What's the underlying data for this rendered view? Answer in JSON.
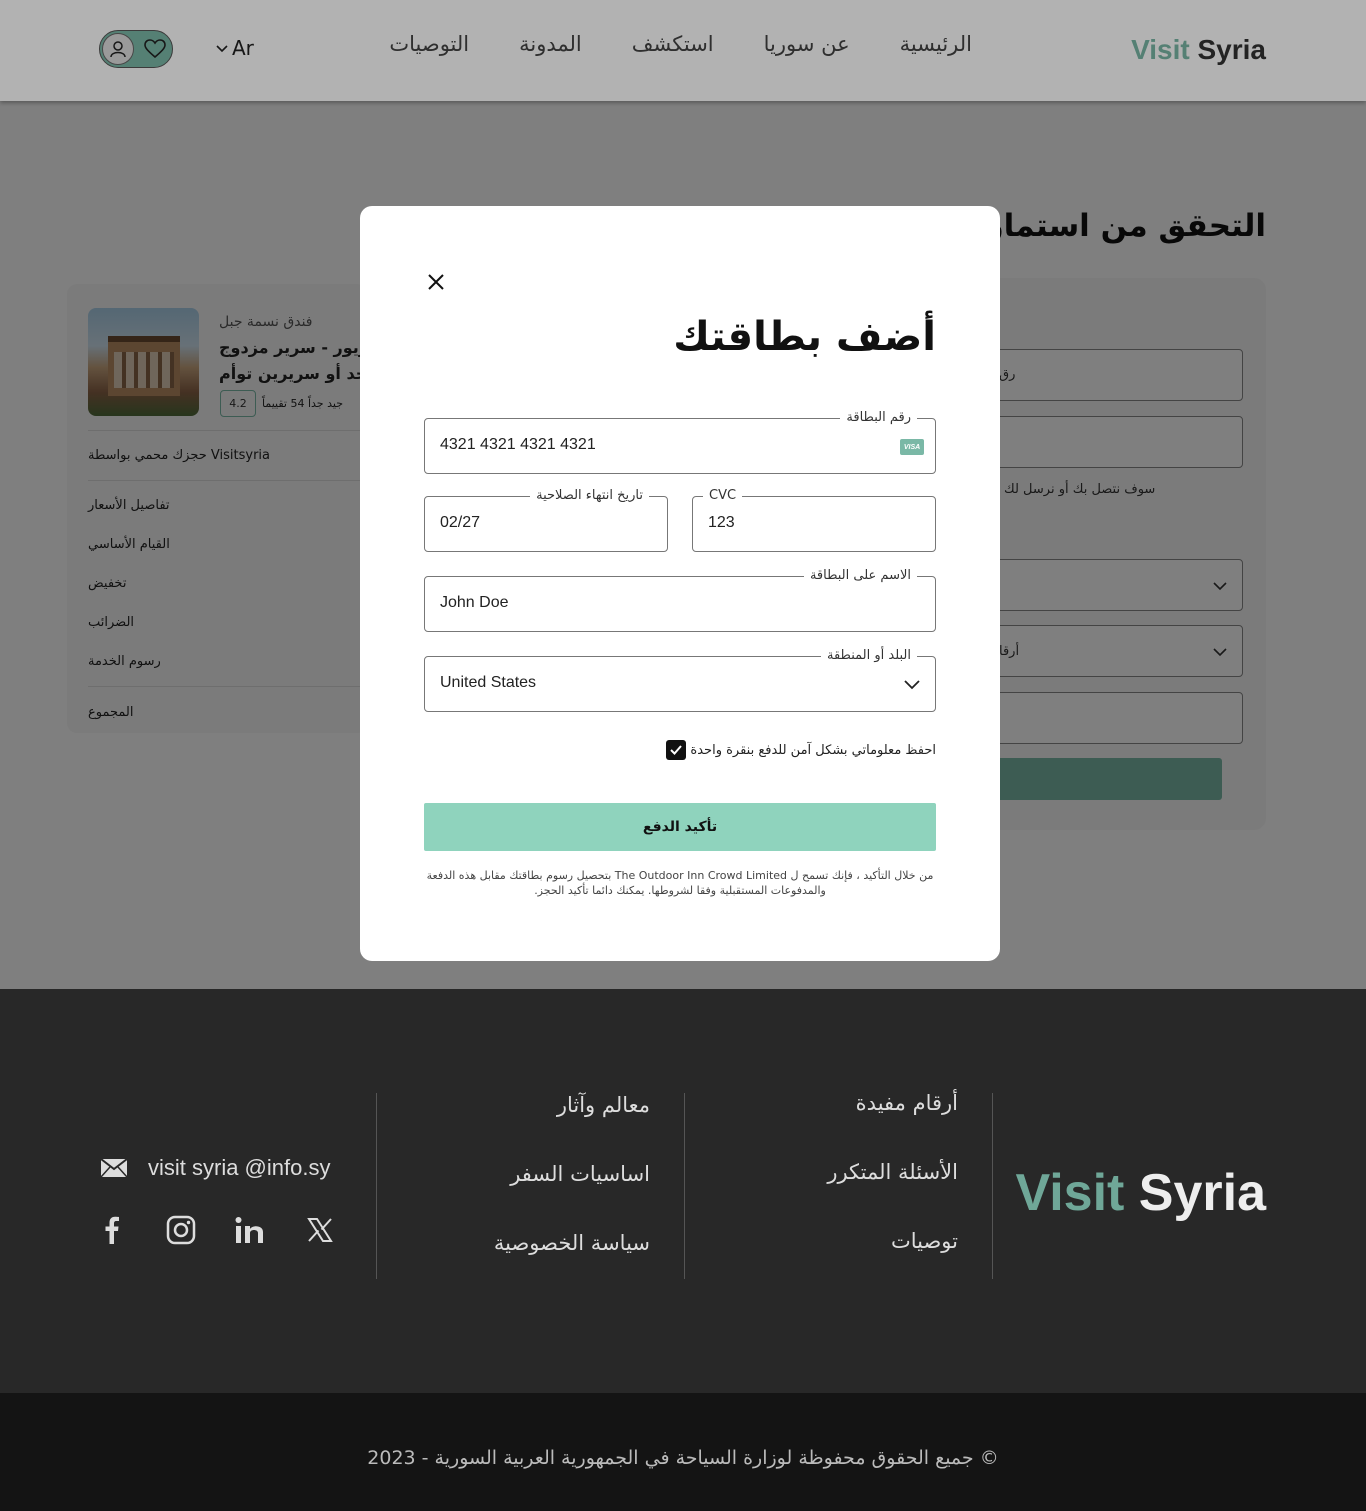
{
  "header": {
    "logo_visit": "Visit",
    "logo_syria": "Syria",
    "nav": [
      "الرئيسية",
      "عن سوريا",
      "استكشف",
      "المدونة",
      "التوصيات"
    ],
    "language": "Ar"
  },
  "page": {
    "title": "التحقق من استمارة ا",
    "field_text_1": "رق",
    "notice": "سوف نتصل بك أو نرسل لك",
    "field_text_2": "أرقا"
  },
  "summary": {
    "hotel_type": "فندق نسمة جبل",
    "room_line1": "ييريور - سرير مزدوج",
    "room_line2": "احد أو سريرين توأم",
    "rating": "4.2",
    "rating_text": "جيد جداً 54 تقييماً",
    "protected": "حجزك محمي بواسطة Visitsyria",
    "price_details": "تفاصيل الأسعار",
    "base_stay": "القيام الأساسي",
    "discount": "تخفيض",
    "taxes": "الضرائب",
    "service_fees": "رسوم الخدمة",
    "total": "المجموع"
  },
  "modal": {
    "title": "أضف بطاقتك",
    "card_number_label": "رقم البطاقة",
    "card_number": "4321 4321 4321 4321",
    "card_brand": "VISA",
    "expiry_label": "تاريخ انتهاء الصلاحية",
    "expiry": "02/27",
    "cvc_label": "CVC",
    "cvc": "123",
    "name_label": "الاسم على البطاقة",
    "name": "John Doe",
    "country_label": "البلد أو المنطقة",
    "country": "United States",
    "save_label": "احفظ معلوماتي بشكل آمن للدفع بنقرة واحدة",
    "save_checked": true,
    "confirm": "تأكيد الدفع",
    "legal": "من خلال التأكيد ، فإنك تسمح ل The Outdoor Inn Crowd Limited بتحصيل رسوم بطاقتك مقابل هذه الدفعة والمدفوعات المستقبلية وفقا لشروطها. يمكنك دائما تأكيد الحجز."
  },
  "footer": {
    "logo_visit": "Visit",
    "logo_syria": "Syria",
    "col1": [
      "أرقام مفيدة",
      "الأسئلة المتكرر",
      "توصيات"
    ],
    "col2": [
      "معالم وآثار",
      "اساسيات السفر",
      "سياسة الخصوصية"
    ],
    "email": "visit syria @info.sy",
    "socials": [
      "x-icon",
      "linkedin-icon",
      "instagram-icon",
      "facebook-icon"
    ],
    "copyright": "جميع الحقوق محفوظة لوزارة السياحة في الجمهورية العربية السورية - 2023 ©"
  },
  "colors": {
    "accent": "#7ab8a6",
    "confirm_button": "#8fd3bd",
    "footer_bg": "#282828",
    "bottom_bar": "#141414"
  }
}
